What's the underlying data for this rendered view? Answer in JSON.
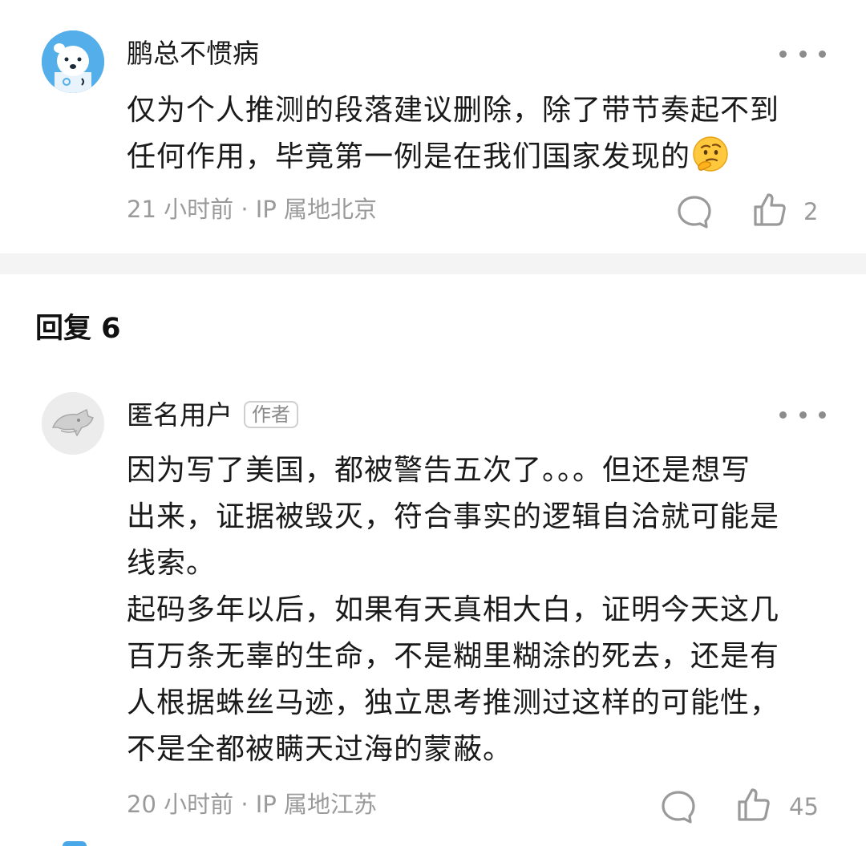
{
  "comments": [
    {
      "author": "鹏总不惯病",
      "content_lines": [
        "仅为个人推测的段落建议删除，除了带节奏起不到",
        "任何作用，毕竟第一例是在我们国家发现的"
      ],
      "emoji": "thinking-face-emoji",
      "time": "21 小时前",
      "separator": "·",
      "ip": "IP 属地北京",
      "like_count": "2"
    }
  ],
  "replies_section": {
    "title": "回复 6"
  },
  "replies": [
    {
      "author": "匿名用户",
      "badge": "作者",
      "content_lines": [
        "因为写了美国，都被警告五次了。。。但还是想写",
        "出来，证据被毁灭，符合事实的逻辑自洽就可能是",
        "线索。",
        "起码多年以后，如果有天真相大白，证明今天这几",
        "百万条无辜的生命，不是糊里糊涂的死去，还是有",
        "人根据蛛丝马迹，独立思考推测过这样的可能性，",
        "不是全都被瞒天过海的蒙蔽。"
      ],
      "time": "20 小时前",
      "separator": "·",
      "ip": "IP 属地江苏",
      "like_count": "45"
    }
  ],
  "colors": {
    "text": "#1a1a1a",
    "meta": "#9a9a9a",
    "divider": "#f4f4f4",
    "avatar_blue": "#4aa7e8"
  }
}
